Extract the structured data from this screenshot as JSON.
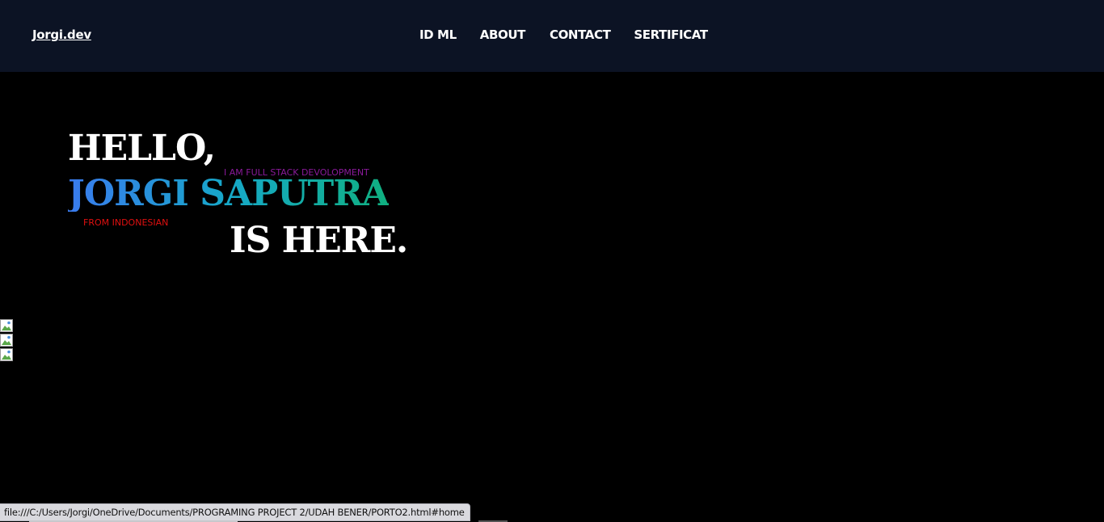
{
  "navbar": {
    "brand": "Jorgi.dev",
    "links": [
      "ID ML",
      "ABOUT",
      "CONTACT",
      "SERTIFICAT"
    ]
  },
  "hero": {
    "greeting": "HELLO,",
    "role": "I AM FULL STACK DEVOLOPMENT",
    "name": "JORGI SAPUTRA",
    "origin": "FROM INDONESIAN",
    "closing": "IS HERE."
  },
  "images": [
    {
      "icon": "broken-image-icon"
    },
    {
      "icon": "broken-image-icon"
    },
    {
      "icon": "broken-image-icon"
    }
  ],
  "status_bar": {
    "url": "file:///C:/Users/Jorgi/OneDrive/Documents/PROGRAMING PROJECT 2/UDAH BENER/PORTO2.html#home"
  },
  "colors": {
    "navbar_bg": "#0c1324",
    "page_bg": "#000000",
    "role_text": "#8a1a9a",
    "origin_text": "#e01010",
    "name_gradient_start": "#3a7bef",
    "name_gradient_end": "#10b080"
  }
}
